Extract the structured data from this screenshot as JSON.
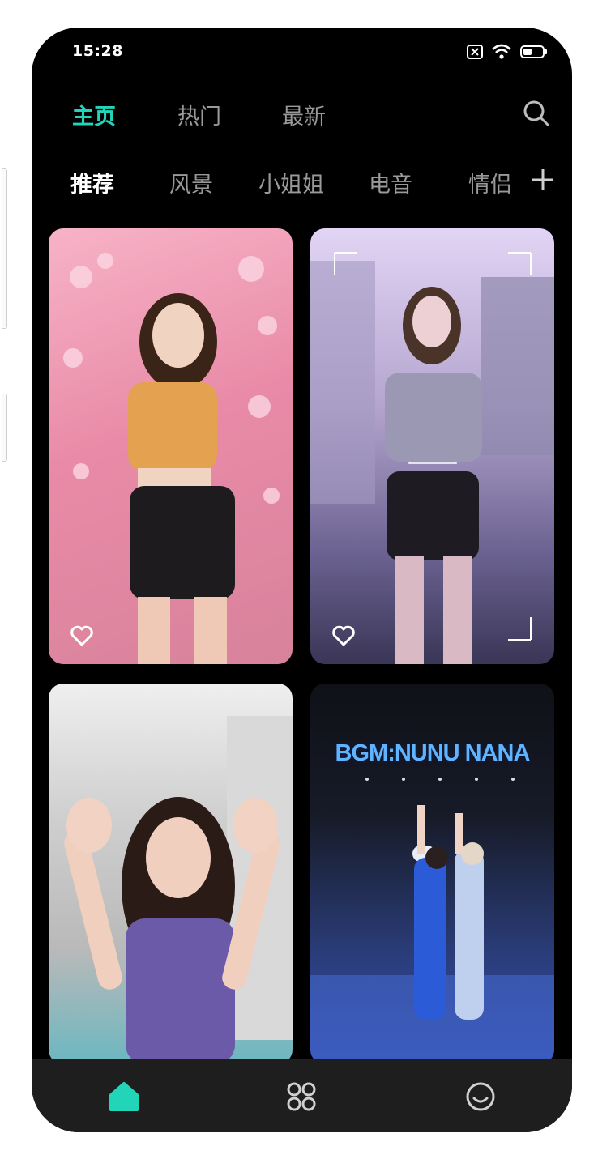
{
  "status": {
    "time": "15:28"
  },
  "top_tabs": [
    {
      "label": "主页",
      "active": true
    },
    {
      "label": "热门",
      "active": false
    },
    {
      "label": "最新",
      "active": false
    }
  ],
  "categories": [
    {
      "label": "推荐",
      "active": true
    },
    {
      "label": "风景",
      "active": false
    },
    {
      "label": "小姐姐",
      "active": false
    },
    {
      "label": "电音",
      "active": false
    },
    {
      "label": "情侣",
      "active": false
    }
  ],
  "cards": [
    {
      "overlay_text": "",
      "liked": false
    },
    {
      "overlay_text": "",
      "liked": false
    },
    {
      "overlay_text": "",
      "liked": false
    },
    {
      "overlay_text": "BGM:NUNU NANA",
      "liked": false
    }
  ],
  "colors": {
    "accent": "#22d4b8",
    "background": "#000000",
    "bottom_bar": "#1e1e1e"
  },
  "bottom_nav": [
    {
      "icon": "home-icon",
      "active": true
    },
    {
      "icon": "grid-apps-icon",
      "active": false
    },
    {
      "icon": "smile-profile-icon",
      "active": false
    }
  ]
}
